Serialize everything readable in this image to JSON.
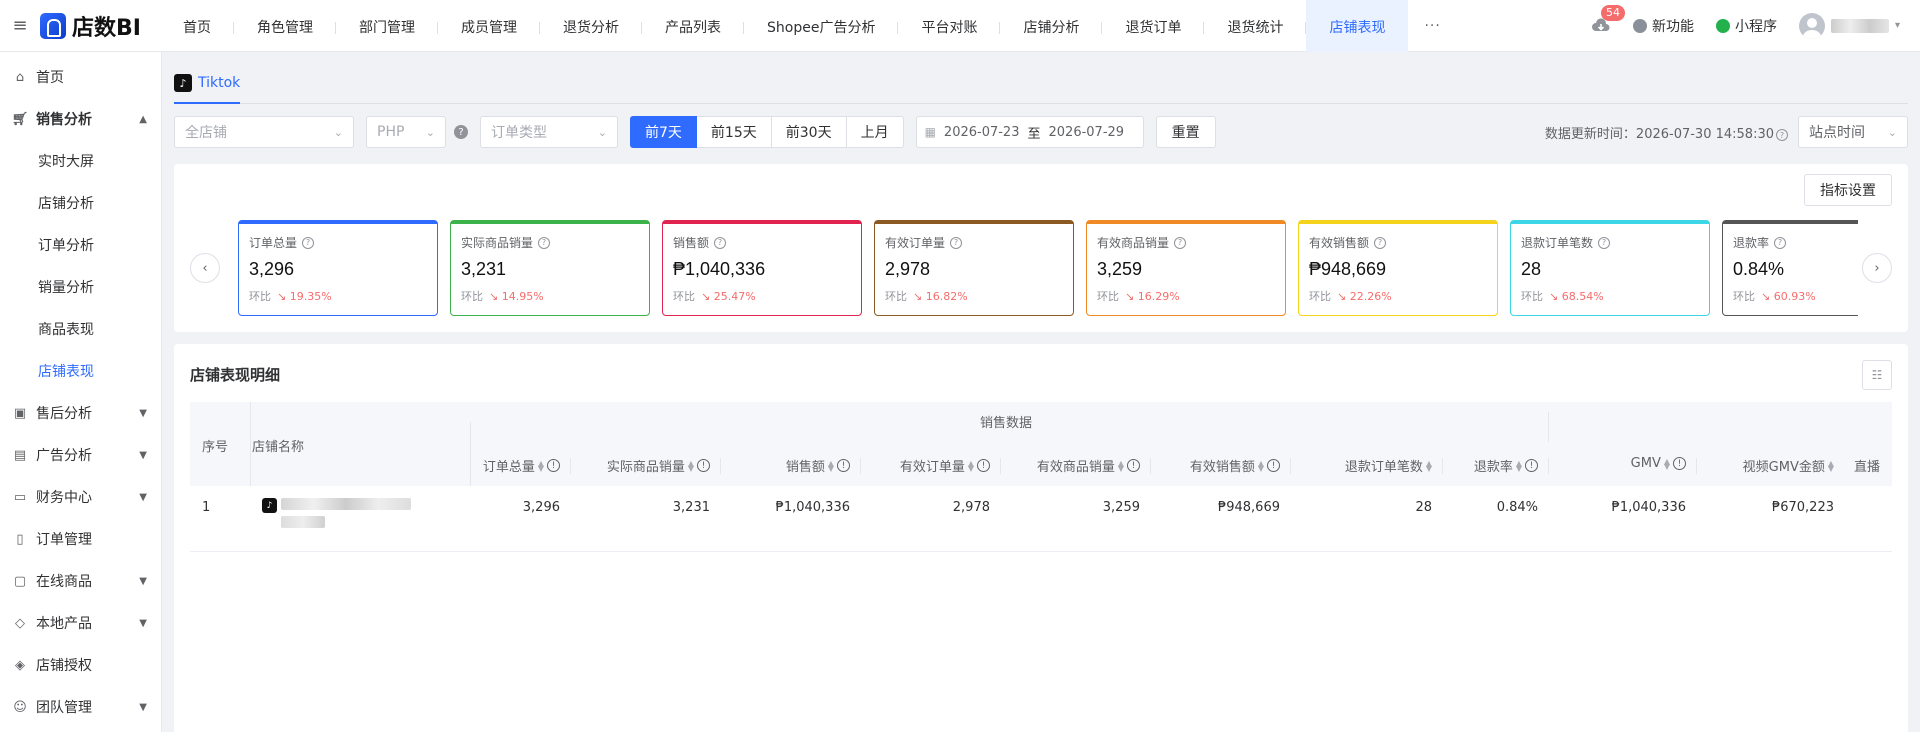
{
  "app": {
    "logo_text": "店数BI"
  },
  "nav": [
    "首页",
    "角色管理",
    "部门管理",
    "成员管理",
    "退货分析",
    "产品列表",
    "Shopee广告分析",
    "平台对账",
    "店铺分析",
    "退货订单",
    "退货统计",
    "店铺表现"
  ],
  "nav_more": "···",
  "topbar": {
    "download_badge": "54",
    "new_feature": "新功能",
    "mini_program": "小程序"
  },
  "sidebar": {
    "home": "首页",
    "sales": "销售分析",
    "sales_sub": [
      "实时大屏",
      "店铺分析",
      "订单分析",
      "销量分析",
      "商品表现",
      "店铺表现"
    ],
    "groups": [
      "售后分析",
      "广告分析",
      "财务中心",
      "订单管理",
      "在线商品",
      "本地产品",
      "店铺授权",
      "团队管理"
    ]
  },
  "tab": {
    "label": "Tiktok"
  },
  "filters": {
    "shop": "全店铺",
    "currency": "PHP",
    "order_type": "订单类型",
    "ranges": [
      "前7天",
      "前15天",
      "前30天",
      "上月"
    ],
    "date_start": "2026-07-23",
    "date_sep": "至",
    "date_end": "2026-07-29",
    "reset": "重置",
    "update_label": "数据更新时间：2026-07-30 14:58:30",
    "tz": "站点时间"
  },
  "metrics_button": "指标设置",
  "kpis": [
    {
      "title": "订单总量",
      "value": "3,296",
      "change": "19.35%",
      "color": "#2f6bff"
    },
    {
      "title": "实际商品销量",
      "value": "3,231",
      "change": "14.95%",
      "color": "#3bb34a"
    },
    {
      "title": "销售额",
      "value": "₱1,040,336",
      "change": "25.47%",
      "color": "#e0244f"
    },
    {
      "title": "有效订单量",
      "value": "2,978",
      "change": "16.82%",
      "color": "#8b5a22"
    },
    {
      "title": "有效商品销量",
      "value": "3,259",
      "change": "16.29%",
      "color": "#f08a24"
    },
    {
      "title": "有效销售额",
      "value": "₱948,669",
      "change": "22.26%",
      "color": "#f5d21c"
    },
    {
      "title": "退款订单笔数",
      "value": "28",
      "change": "68.54%",
      "color": "#3dd6e6"
    },
    {
      "title": "退款率",
      "value": "0.84%",
      "change": "60.93%",
      "color": "#555555"
    }
  ],
  "kpi_change_label": "环比",
  "detail": {
    "title": "店铺表现明细",
    "group_header": "销售数据",
    "col_index": "序号",
    "col_shop": "店铺名称",
    "cols": [
      "订单总量",
      "实际商品销量",
      "销售额",
      "有效订单量",
      "有效商品销量",
      "有效销售额",
      "退款订单笔数",
      "退款率",
      "GMV",
      "视频GMV金额",
      "直播"
    ],
    "rows": [
      {
        "index": "1",
        "values": [
          "3,296",
          "3,231",
          "₱1,040,336",
          "2,978",
          "3,259",
          "₱948,669",
          "28",
          "0.84%",
          "₱1,040,336",
          "₱670,223"
        ]
      }
    ]
  }
}
